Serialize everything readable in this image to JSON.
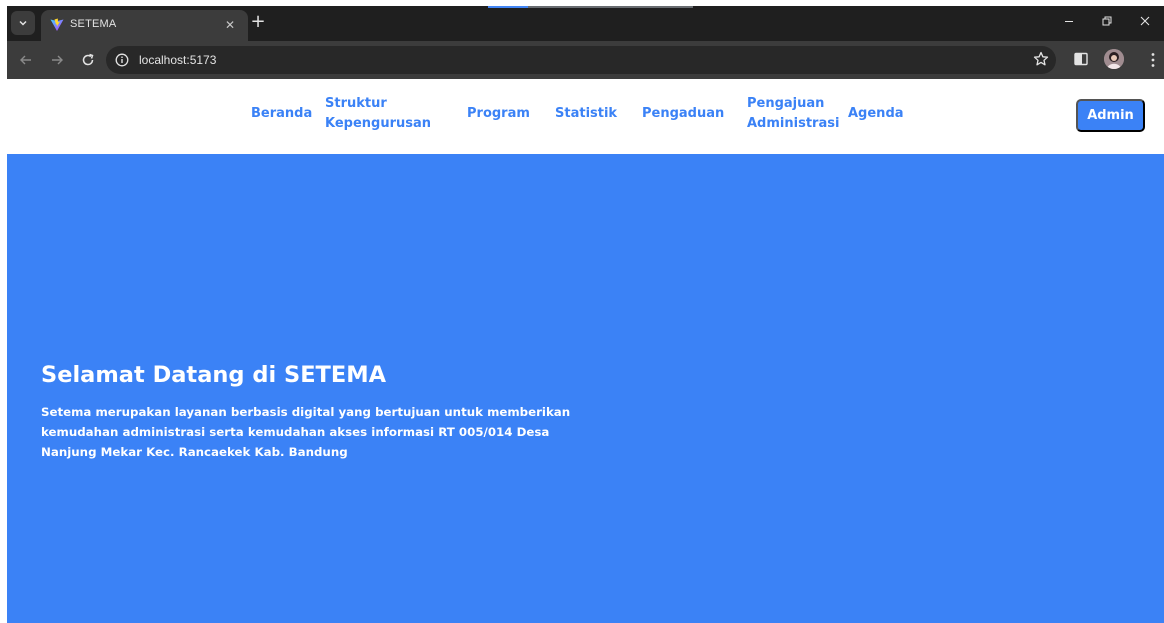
{
  "browser": {
    "tab_title": "SETEMA",
    "url": "localhost:5173",
    "icons": {
      "tab_search": "chevron-down-icon",
      "favicon": "vite-logo-icon",
      "close_tab": "close-icon",
      "new_tab": "plus-icon",
      "back": "arrow-left-icon",
      "forward": "arrow-right-icon",
      "reload": "reload-icon",
      "site_info": "info-icon",
      "bookmark": "star-icon",
      "side_panel": "side-panel-icon",
      "profile": "avatar",
      "menu": "kebab-menu-icon"
    }
  },
  "nav": {
    "items": [
      {
        "label": "Beranda"
      },
      {
        "label": "Struktur",
        "label2": "Kepengurusan"
      },
      {
        "label": "Program"
      },
      {
        "label": "Statistik"
      },
      {
        "label": "Pengaduan"
      },
      {
        "label": "Pengajuan",
        "label2": "Administrasi"
      },
      {
        "label": "Agenda"
      }
    ],
    "admin_label": "Admin"
  },
  "hero": {
    "title": "Selamat Datang di SETEMA",
    "description": "Setema merupakan layanan berbasis digital yang bertujuan untuk memberikan kemudahan administrasi serta kemudahan akses informasi RT 005/014 Desa Nanjung Mekar Kec. Rancaekek Kab. Bandung"
  },
  "colors": {
    "accent": "#3b82f6",
    "chrome_dark": "#1f1f1f",
    "chrome_toolbar": "#3c3c3c",
    "page_bg": "#ffffff",
    "hero_text": "#ffffff"
  }
}
